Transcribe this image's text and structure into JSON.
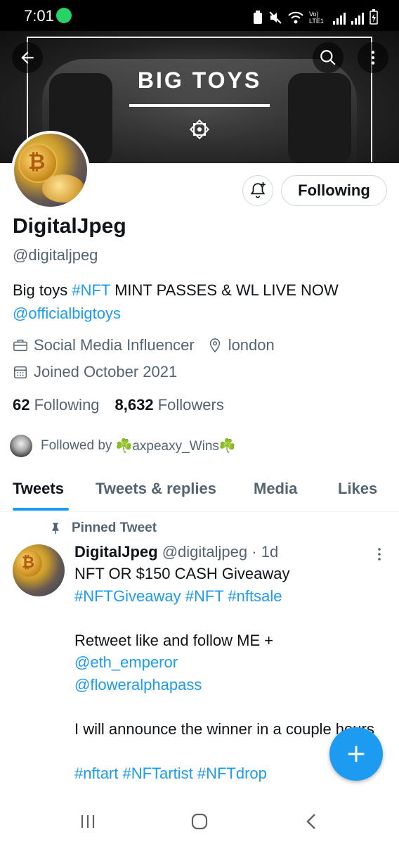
{
  "status_bar": {
    "time": "7:01",
    "network_label": "Vo) LTE1"
  },
  "banner": {
    "title": "BIG TOYS"
  },
  "header": {
    "back_icon": "arrow-left-icon",
    "search_icon": "search-icon",
    "more_icon": "more-vertical-icon"
  },
  "profile": {
    "display_name": "DigitalJpeg",
    "handle": "@digitaljpeg",
    "bio_text_1": "Big toys ",
    "bio_hashtag": "#NFT",
    "bio_text_2": " MINT PASSES & WL LIVE NOW",
    "bio_mention": "@officialbigtoys",
    "category": "Social Media Influencer",
    "location": "london",
    "joined": "Joined October 2021",
    "following_count": "62",
    "following_label": "Following",
    "followers_count": "8,632",
    "followers_label": "Followers",
    "followed_by_prefix": "Followed by ",
    "followed_by_user": "☘️axpeaxy_Wins☘️"
  },
  "actions": {
    "following_button": "Following",
    "notify_icon": "bell-plus-icon"
  },
  "tabs": [
    {
      "label": "Tweets",
      "active": true
    },
    {
      "label": "Tweets & replies",
      "active": false
    },
    {
      "label": "Media",
      "active": false
    },
    {
      "label": "Likes",
      "active": false
    }
  ],
  "pinned_tweet": {
    "pinned_label": "Pinned Tweet",
    "author_name": "DigitalJpeg",
    "author_handle": "@digitaljpeg",
    "separator": "·",
    "time": "1d",
    "line1": "NFT OR $150 CASH Giveaway",
    "hashtags_line": "#NFTGiveaway #NFT #nftsale",
    "line3": "Retweet like and follow ME +",
    "mention1": "@eth_emperor",
    "mention2": "@floweralphapass",
    "line6": "I will announce the winner in a couple hours",
    "hashtags_line2": "#nftart #NFTartist #NFTdrop"
  },
  "fab": {
    "icon": "plus-icon"
  },
  "colors": {
    "accent": "#1d9bf0",
    "text": "#0f1419",
    "secondary": "#536471"
  }
}
